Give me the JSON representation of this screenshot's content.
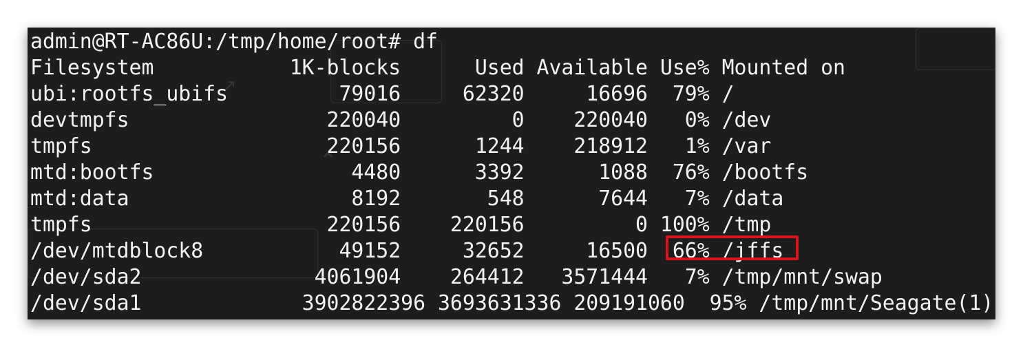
{
  "terminal": {
    "prompt_line": "admin@RT-AC86U:/tmp/home/root# df",
    "header": "Filesystem           1K-blocks      Used Available Use% Mounted on",
    "rows": [
      "ubi:rootfs_ubifs         79016     62320     16696  79% /",
      "devtmpfs                220040         0    220040   0% /dev",
      "tmpfs                   220156      1244    218912   1% /var",
      "mtd:bootfs                4480      3392      1088  76% /bootfs",
      "mtd:data                  8192       548      7644   7% /data",
      "tmpfs                   220156    220156         0 100% /tmp",
      "/dev/mtdblock8           49152     32652     16500  66% /jffs",
      "/dev/sda2              4061904    264412   3571444   7% /tmp/mnt/swap",
      "/dev/sda1             3902822396 3693631336 209191060  95% /tmp/mnt/Seagate(1)"
    ]
  },
  "colors": {
    "background": "#1d1d1d",
    "text": "#f2f2f2",
    "highlight": "#d9141c"
  }
}
